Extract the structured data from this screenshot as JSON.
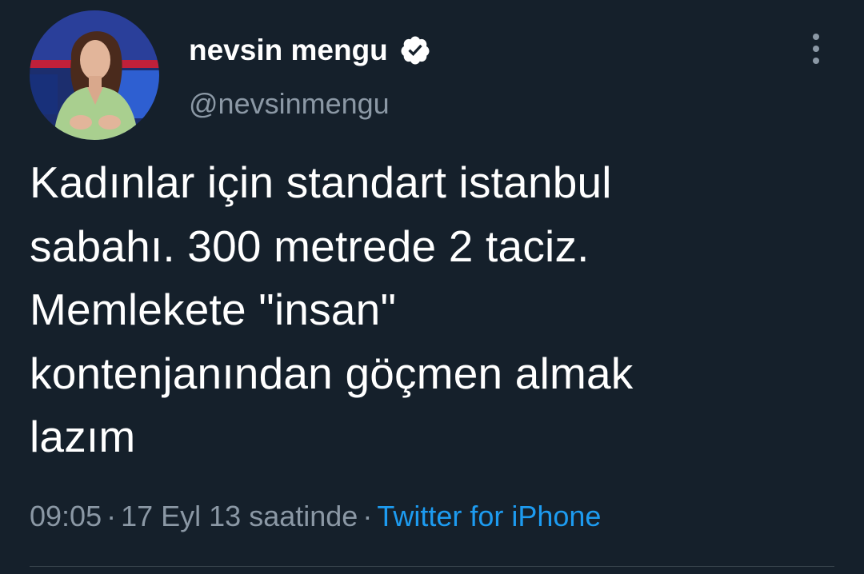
{
  "author": {
    "display_name": "nevsin mengu",
    "handle": "@nevsinmengu",
    "verified": true,
    "avatar_icon": "profile-photo"
  },
  "tweet": {
    "text": "Kadınlar için standart istanbul\nsabahı. 300 metrede 2 taciz.\nMemlekete \"insan\"\nkontenjanından göçmen almak\nlazım"
  },
  "meta": {
    "time": "09:05",
    "separator": "·",
    "date": "17 Eyl 13 saatinde",
    "source": "Twitter for iPhone"
  },
  "colors": {
    "background": "#15202b",
    "text_primary": "#ffffff",
    "text_secondary": "#8b98a5",
    "link": "#1d9bf0",
    "divider": "#38444d"
  },
  "icons": {
    "more": "more-vertical-icon",
    "verified": "verified-badge-icon"
  }
}
